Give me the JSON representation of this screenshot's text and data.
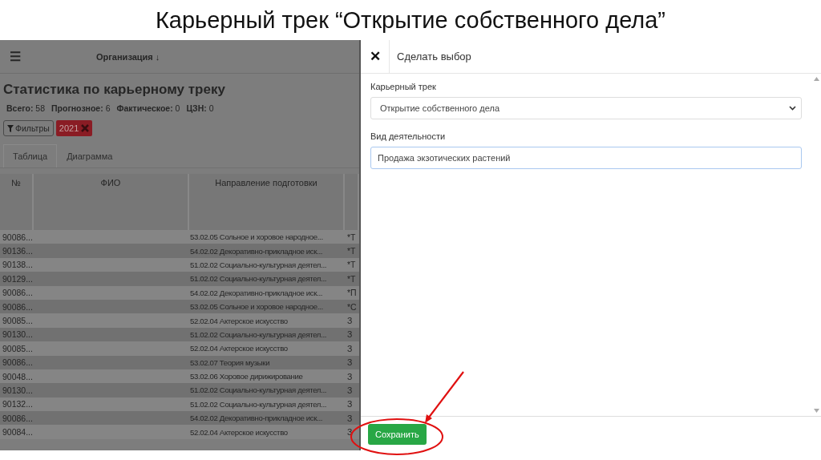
{
  "slide_title": "Карьерный трек “Открытие собственного дела”",
  "topbar": {
    "menu_icon": "☰",
    "organization": "Организация ↓"
  },
  "page_title": "Статистика по карьерному треку",
  "stats": [
    {
      "label": "Всего:",
      "value": "58"
    },
    {
      "label": "Прогнозное:",
      "value": "6"
    },
    {
      "label": "Фактическое:",
      "value": "0"
    },
    {
      "label": "ЦЗН:",
      "value": "0"
    }
  ],
  "filters_button": "Фильтры",
  "filter_tag": "2021",
  "tabs": [
    {
      "label": "Таблица",
      "selected": true
    },
    {
      "label": "Диаграмма",
      "selected": false
    }
  ],
  "table": {
    "columns": [
      "№",
      "ФИО",
      "Направление подготовки"
    ],
    "rows": [
      {
        "number": "90086...",
        "direction": "53.02.05 Сольное и хоровое народное...",
        "column_4": "*Т"
      },
      {
        "number": "90136...",
        "direction": "54.02.02 Декоративно-прикладное иск...",
        "column_4": "*Т"
      },
      {
        "number": "90138...",
        "direction": "51.02.02 Социально-культурная деятел...",
        "column_4": "*Т"
      },
      {
        "number": "90129...",
        "direction": "51.02.02 Социально-культурная деятел...",
        "column_4": "*Т"
      },
      {
        "number": "90086...",
        "direction": "54.02.02 Декоративно-прикладное иск...",
        "column_4": "*П"
      },
      {
        "number": "90086...",
        "direction": "53.02.05 Сольное и хоровое народное...",
        "column_4": "*С"
      },
      {
        "number": "90085...",
        "direction": "52.02.04 Актерское искусство",
        "column_4": "З"
      },
      {
        "number": "90130...",
        "direction": "51.02.02 Социально-культурная деятел...",
        "column_4": "З"
      },
      {
        "number": "90085...",
        "direction": "52.02.04 Актерское искусство",
        "column_4": "З"
      },
      {
        "number": "90086...",
        "direction": "53.02.07 Теория музыки",
        "column_4": "З"
      },
      {
        "number": "90048...",
        "direction": "53.02.06 Хоровое дирижирование",
        "column_4": "З"
      },
      {
        "number": "90130...",
        "direction": "51.02.02 Социально-культурная деятел...",
        "column_4": "З"
      },
      {
        "number": "90132...",
        "direction": "51.02.02 Социально-культурная деятел...",
        "column_4": "З"
      },
      {
        "number": "90086...",
        "direction": "54.02.02 Декоративно-прикладное иск...",
        "column_4": "З"
      },
      {
        "number": "90084...",
        "direction": "52.02.04 Актерское искусство",
        "column_4": "З"
      }
    ]
  },
  "panel": {
    "close": "✕",
    "title": "Сделать выбор",
    "fields": [
      {
        "kind": "select",
        "label": "Карьерный трек",
        "value": "Открытие собственного дела"
      },
      {
        "kind": "text",
        "label": "Вид деятельности",
        "value": "Продажа экзотических растений",
        "focused": true
      }
    ],
    "save_button": "Сохранить"
  }
}
